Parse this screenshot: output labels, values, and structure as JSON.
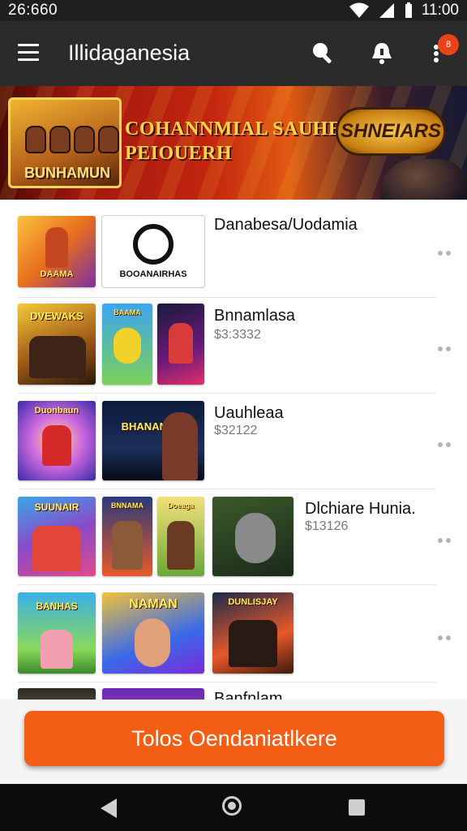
{
  "status_bar": {
    "time_left": "26:660",
    "time_right": "11:00"
  },
  "app_bar": {
    "title": "Illidaganesia",
    "notification_badge": "8"
  },
  "banner": {
    "left_logo_text": "BUNHAMUN",
    "headline_line1": "COHANNMIAL SAUHE",
    "headline_line2": "PEIOUERH",
    "right_logo_text": "SHNEIARS"
  },
  "list": [
    {
      "title": "Danabesa/Uodamia",
      "subtitle": "",
      "thumb_captions": [
        "DAAMA",
        "BOOANAIRHAS"
      ]
    },
    {
      "title": "Bnnamlasa",
      "subtitle": "$3:3332",
      "thumb_captions": [
        "DVEWAKS",
        "BAAMA",
        ""
      ]
    },
    {
      "title": "Uauhleaa",
      "subtitle": "$32122",
      "thumb_captions": [
        "Duonbaun",
        "BHANANAIA"
      ]
    },
    {
      "title": "Dlchiare Hunia.",
      "subtitle": "$13126",
      "thumb_captions": [
        "SUUNAIR",
        "BNNAMA",
        "Doeaga",
        ""
      ]
    },
    {
      "title": "",
      "subtitle": "",
      "thumb_captions": [
        "BANHAS",
        "NAMAN",
        "DUNLISJAY"
      ]
    },
    {
      "title": "Banfnlam",
      "subtitle": "",
      "thumb_captions": [
        "",
        ""
      ]
    }
  ],
  "cta": {
    "label": "Tolos Oendaniatlkere"
  },
  "colors": {
    "accent": "#f35d14",
    "appbar": "#2b2b2b",
    "badge": "#e8431b"
  }
}
